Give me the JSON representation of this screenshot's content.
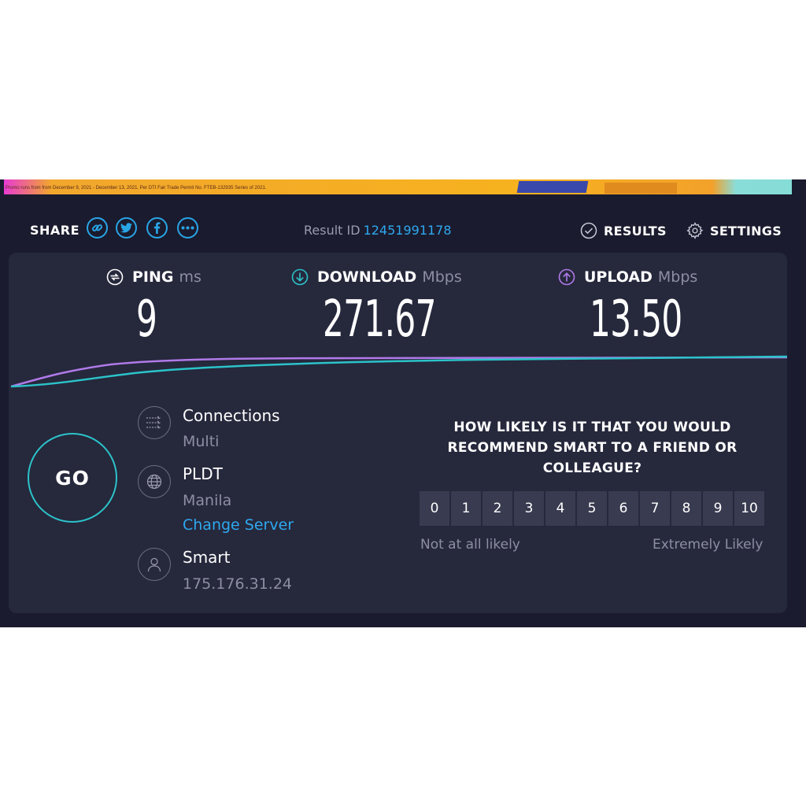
{
  "ad": {
    "disclaimer": "Promo runs from from December 9, 2021 - December 13, 2021. Per DTI Fair Trade Permit No. FTEB-132935 Series of 2021."
  },
  "header": {
    "share_label": "SHARE",
    "share_buttons": [
      "link-icon",
      "twitter-icon",
      "facebook-icon",
      "more-icon"
    ],
    "result_label": "Result ID",
    "result_id": "12451991178",
    "results_label": "RESULTS",
    "settings_label": "SETTINGS"
  },
  "metrics": {
    "ping": {
      "label": "PING",
      "unit": "ms",
      "value": "9"
    },
    "download": {
      "label": "DOWNLOAD",
      "unit": "Mbps",
      "value": "271.67"
    },
    "upload": {
      "label": "UPLOAD",
      "unit": "Mbps",
      "value": "13.50"
    }
  },
  "go_label": "GO",
  "connections": {
    "title": "Connections",
    "value": "Multi"
  },
  "server": {
    "isp": "PLDT",
    "location": "Manila",
    "change_label": "Change Server"
  },
  "client": {
    "provider": "Smart",
    "ip": "175.176.31.24"
  },
  "survey": {
    "question": "HOW LIKELY IS IT THAT YOU WOULD RECOMMEND SMART TO A FRIEND OR COLLEAGUE?",
    "scale": [
      "0",
      "1",
      "2",
      "3",
      "4",
      "5",
      "6",
      "7",
      "8",
      "9",
      "10"
    ],
    "low_label": "Not at all likely",
    "high_label": "Extremely Likely"
  },
  "colors": {
    "background": "#1a1b2e",
    "panel": "#26283c",
    "accent_blue": "#2ea8ef",
    "download_cyan": "#2bc3c9",
    "upload_purple": "#b07ae8"
  }
}
